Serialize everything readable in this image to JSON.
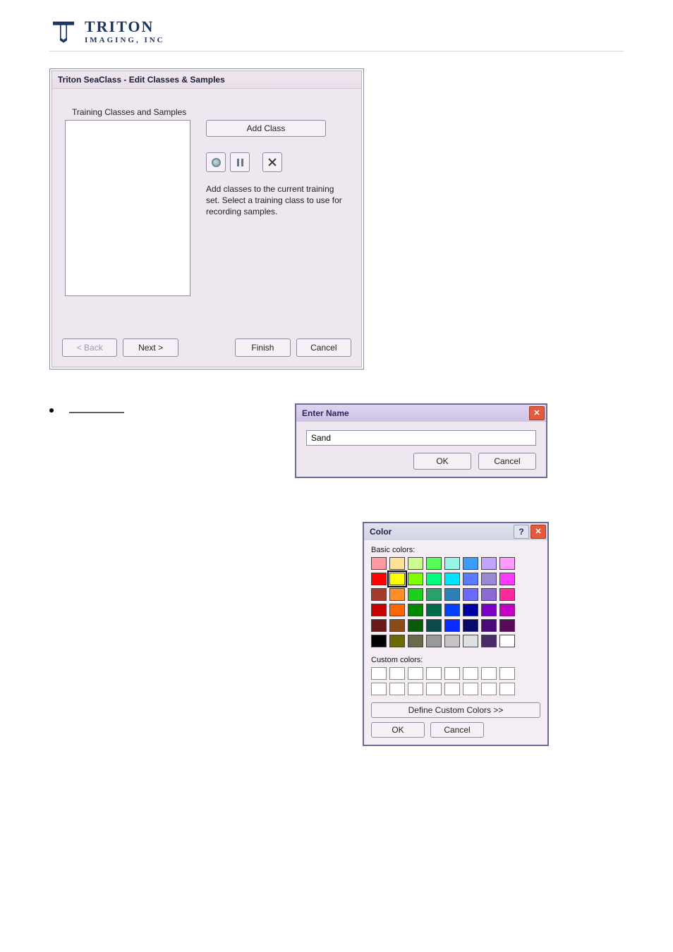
{
  "brand": {
    "name": "TRITON",
    "sub": "IMAGING,  INC"
  },
  "mainWin": {
    "title": "Triton SeaClass - Edit Classes & Samples",
    "listLabel": "Training Classes and Samples",
    "addClass": "Add Class",
    "hint": "Add classes to the current training set.  Select a training class to use for recording samples.",
    "back": "< Back",
    "next": "Next >",
    "finish": "Finish",
    "cancel": "Cancel"
  },
  "enterName": {
    "title": "Enter Name",
    "value": "Sand",
    "ok": "OK",
    "cancel": "Cancel"
  },
  "colorWin": {
    "title": "Color",
    "basicLabel": "Basic colors:",
    "customLabel": "Custom colors:",
    "define": "Define Custom Colors >>",
    "ok": "OK",
    "cancel": "Cancel",
    "selectedIndex": 9,
    "basic": [
      "#ff9aa2",
      "#ffe29a",
      "#c8ff8f",
      "#55ff55",
      "#97f5e8",
      "#3b9cff",
      "#c2a4ff",
      "#ff9aff",
      "#ff0000",
      "#ffff00",
      "#7fff00",
      "#00ff7f",
      "#00e5ff",
      "#5a7aff",
      "#9a8ad6",
      "#ff3aff",
      "#a23a2e",
      "#ff8e25",
      "#1bcf1b",
      "#2aa06a",
      "#2c7fb8",
      "#6a6aff",
      "#8a6ad6",
      "#ff2a9a",
      "#c40000",
      "#ff6600",
      "#008a00",
      "#006a4a",
      "#0040ff",
      "#0000a0",
      "#7a00c4",
      "#c400c4",
      "#6a1a1a",
      "#8a4a1a",
      "#0a5a0a",
      "#0a4a4a",
      "#0a2aff",
      "#0a0a6a",
      "#4a0a7a",
      "#5a0a5a",
      "#000000",
      "#6a6a00",
      "#6a6a4a",
      "#9a9a9a",
      "#c4c4c4",
      "#e0e0e0",
      "#4a2a6a",
      "#ffffff"
    ]
  }
}
